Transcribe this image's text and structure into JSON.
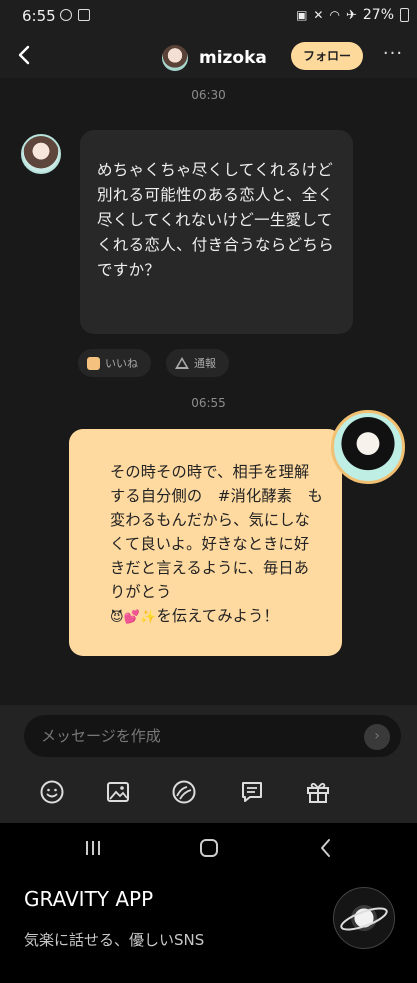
{
  "status_bar": {
    "time": "6:55",
    "battery": "27%"
  },
  "header": {
    "username": "mizoka",
    "follow_label": "フォロー",
    "more_label": "···"
  },
  "chat": {
    "timestamp_1": "06:30",
    "incoming_message": "めちゃくちゃ尽くしてくれるけど別れる可能性のある恋人と、全く尽くしてくれないけど一生愛してくれる恋人、付き合うならどちらですか？",
    "reactions": {
      "like_label": "いいね",
      "report_label": "通報"
    },
    "timestamp_2": "06:55",
    "outgoing_message_text": "その時その時で、相手を理解する自分側の　#消化酵素　も変わるもんだから、気にしなくて良いよ。好きなときに好きだと言えるように、毎日ありがとう",
    "outgoing_message_emojis": "😈💕✨",
    "outgoing_message_tail": "を伝えてみよう！"
  },
  "composer": {
    "placeholder": "メッセージを作成"
  },
  "toolbar_icons": [
    "emoji-icon",
    "image-icon",
    "sticker-icon",
    "template-icon",
    "gift-icon"
  ],
  "banner": {
    "title": "GRAVITY APP",
    "subtitle": "気楽に話せる、優しいSNS"
  },
  "colors": {
    "accent": "#fdd99c",
    "outgoing_bubble": "#fed9a0",
    "incoming_bubble": "#282828",
    "background": "#191919"
  }
}
